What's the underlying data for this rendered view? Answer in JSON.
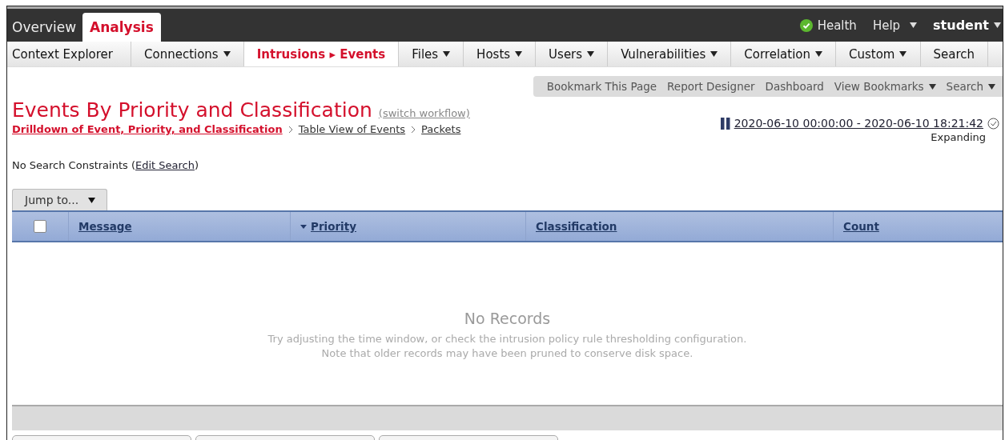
{
  "top_tabs": [
    {
      "label": "Overview",
      "selected": false
    },
    {
      "label": "Analysis",
      "selected": true
    }
  ],
  "top_right": {
    "health": "Health",
    "help": "Help",
    "user": "student"
  },
  "sub_nav": [
    {
      "label": "Context Explorer",
      "selected": false,
      "has_menu": false
    },
    {
      "label": "Connections",
      "selected": false,
      "has_menu": true
    },
    {
      "label": "Intrusions ▸ Events",
      "selected": true,
      "has_menu": false
    },
    {
      "label": "Files",
      "selected": false,
      "has_menu": true
    },
    {
      "label": "Hosts",
      "selected": false,
      "has_menu": true
    },
    {
      "label": "Users",
      "selected": false,
      "has_menu": true
    },
    {
      "label": "Vulnerabilities",
      "selected": false,
      "has_menu": true
    },
    {
      "label": "Correlation",
      "selected": false,
      "has_menu": true
    },
    {
      "label": "Custom",
      "selected": false,
      "has_menu": true
    },
    {
      "label": "Search",
      "selected": false,
      "has_menu": false
    }
  ],
  "toolbar": [
    {
      "label": "Bookmark This Page",
      "has_menu": false
    },
    {
      "label": "Report Designer",
      "has_menu": false
    },
    {
      "label": "Dashboard",
      "has_menu": false
    },
    {
      "label": "View Bookmarks",
      "has_menu": true
    },
    {
      "label": "Search",
      "has_menu": true
    }
  ],
  "title": "Events By Priority and Classification",
  "switch_workflow": "(switch workflow)",
  "breadcrumbs": [
    {
      "label": "Drilldown of Event, Priority, and Classification",
      "selected": true
    },
    {
      "label": "Table View of Events",
      "selected": false
    },
    {
      "label": "Packets",
      "selected": false
    }
  ],
  "time_range": "2020-06-10 00:00:00 - 2020-06-10 18:21:42",
  "time_mode": "Expanding",
  "constraints": {
    "text": "No Search Constraints (",
    "link": "Edit Search",
    "close": ")"
  },
  "jump_to": "Jump to...",
  "table": {
    "select_all_checked": false,
    "columns": [
      {
        "label": "Message",
        "sorted": false
      },
      {
        "label": "Priority",
        "sorted": true
      },
      {
        "label": "Classification",
        "sorted": false
      },
      {
        "label": "Count",
        "sorted": false
      }
    ],
    "empty_title": "No Records",
    "empty_lines": [
      "Try adjusting the time window, or check the intrusion policy rule thresholding configuration.",
      "Note that older records may have been pruned to conserve disk space."
    ]
  }
}
